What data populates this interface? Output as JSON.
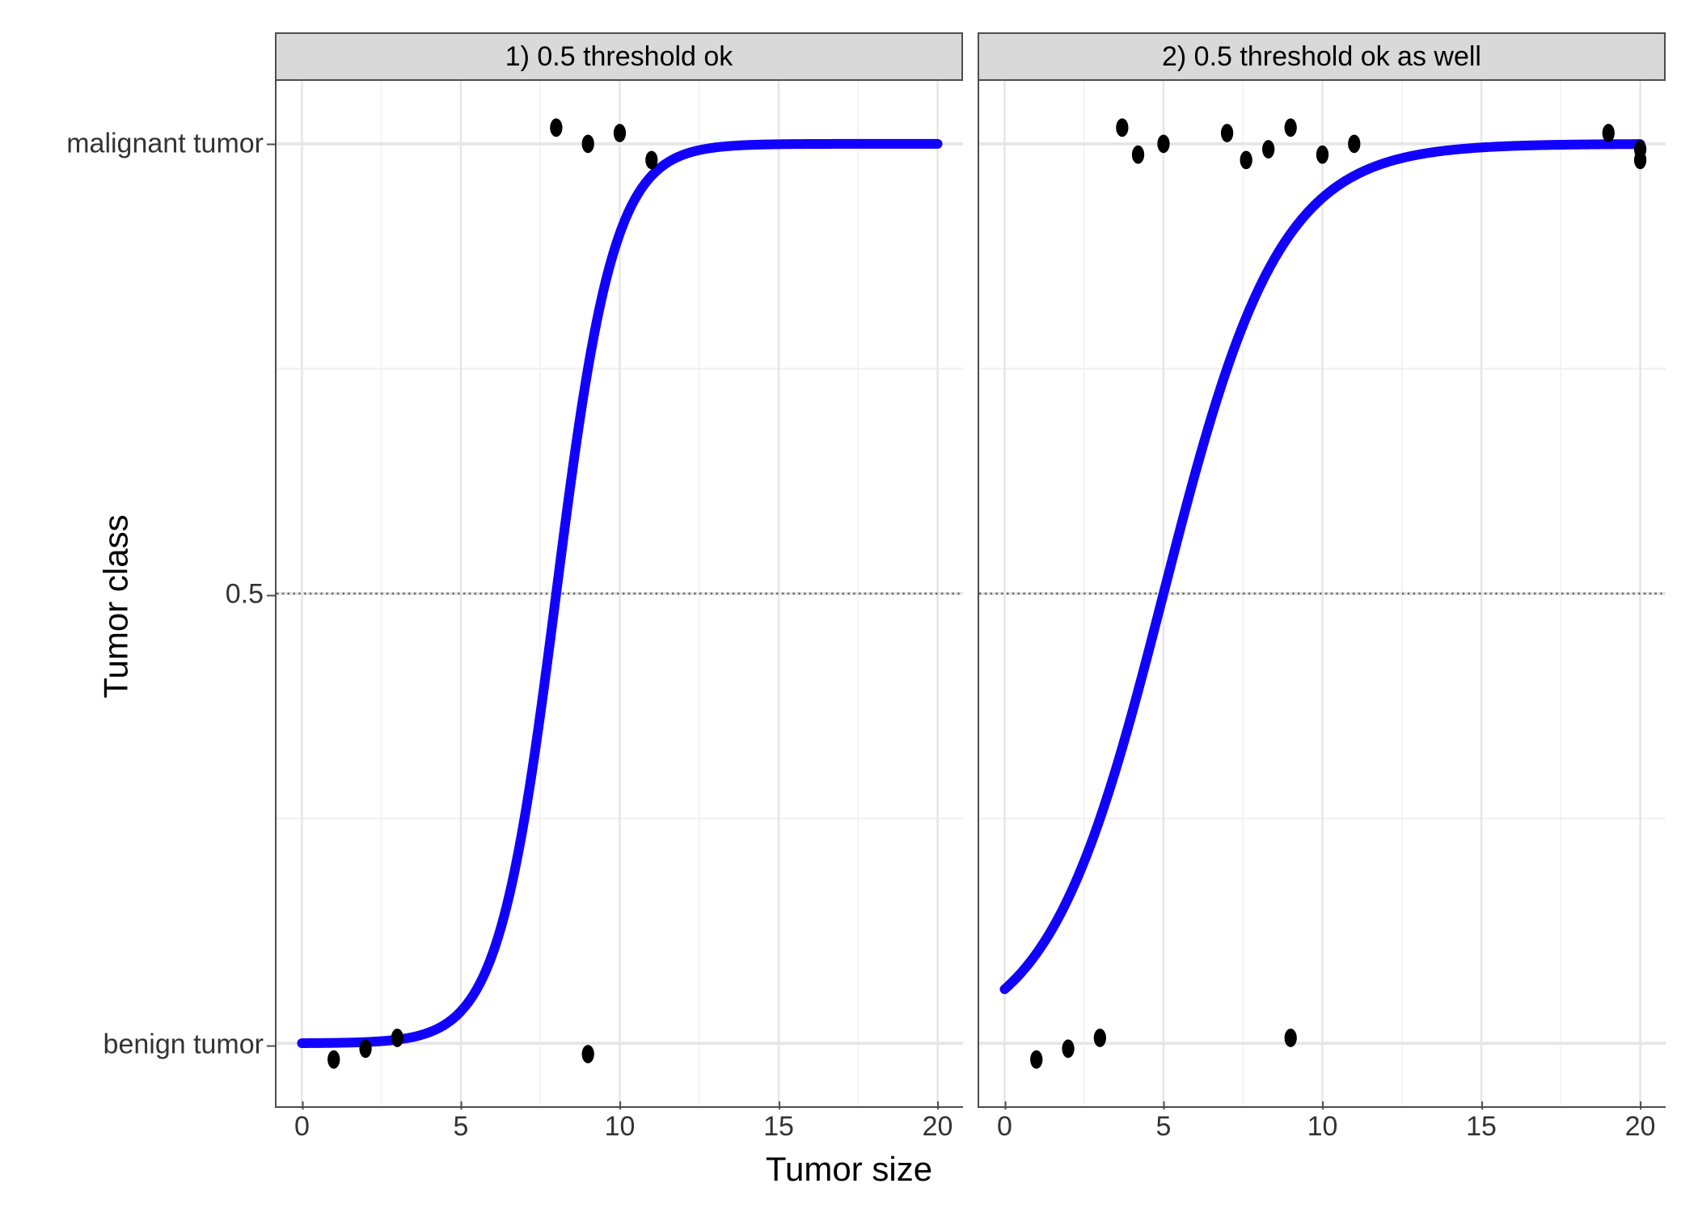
{
  "xlabel": "Tumor size",
  "ylabel": "Tumor class",
  "colors": {
    "curve": "#1100ff",
    "grid_major": "#e6e6e6",
    "grid_minor": "#f2f2f2",
    "panel_border": "#4d4d4d",
    "strip_bg": "#d9d9d9",
    "threshold_line": "#6a6a6a"
  },
  "x": {
    "min": -0.8,
    "max": 20.8,
    "ticks": [
      0,
      5,
      10,
      15,
      20
    ],
    "minor": [
      2.5,
      7.5,
      12.5,
      17.5
    ]
  },
  "y": {
    "min": -0.07,
    "max": 1.07,
    "ticks": [
      {
        "value": 0.0,
        "label": "benign tumor"
      },
      {
        "value": 0.5,
        "label": "0.5"
      },
      {
        "value": 1.0,
        "label": "malignant tumor"
      }
    ],
    "minor": [
      0.25,
      0.75
    ]
  },
  "threshold": 0.5,
  "chart_data": [
    {
      "type": "scatter_with_curve",
      "facet_label": "1) 0.5 threshold ok",
      "points": [
        {
          "x": 1,
          "y": 0
        },
        {
          "x": 2,
          "y": 0
        },
        {
          "x": 3,
          "y": 0
        },
        {
          "x": 8,
          "y": 1
        },
        {
          "x": 9,
          "y": 0
        },
        {
          "x": 9,
          "y": 1
        },
        {
          "x": 10,
          "y": 1
        },
        {
          "x": 11,
          "y": 1
        }
      ],
      "logistic": {
        "midpoint": 8.0,
        "steepness": 1.1
      }
    },
    {
      "type": "scatter_with_curve",
      "facet_label": "2) 0.5 threshold ok as well",
      "points": [
        {
          "x": 1,
          "y": 0
        },
        {
          "x": 2,
          "y": 0
        },
        {
          "x": 3,
          "y": 0
        },
        {
          "x": 3.7,
          "y": 1
        },
        {
          "x": 4.2,
          "y": 1
        },
        {
          "x": 5,
          "y": 1
        },
        {
          "x": 7,
          "y": 1
        },
        {
          "x": 7.6,
          "y": 1
        },
        {
          "x": 8.3,
          "y": 1
        },
        {
          "x": 9,
          "y": 0
        },
        {
          "x": 9,
          "y": 1
        },
        {
          "x": 10,
          "y": 1
        },
        {
          "x": 11,
          "y": 1
        },
        {
          "x": 19,
          "y": 1
        },
        {
          "x": 20,
          "y": 1
        },
        {
          "x": 20,
          "y": 1
        }
      ],
      "logistic": {
        "midpoint": 5.0,
        "steepness": 0.55
      }
    }
  ]
}
